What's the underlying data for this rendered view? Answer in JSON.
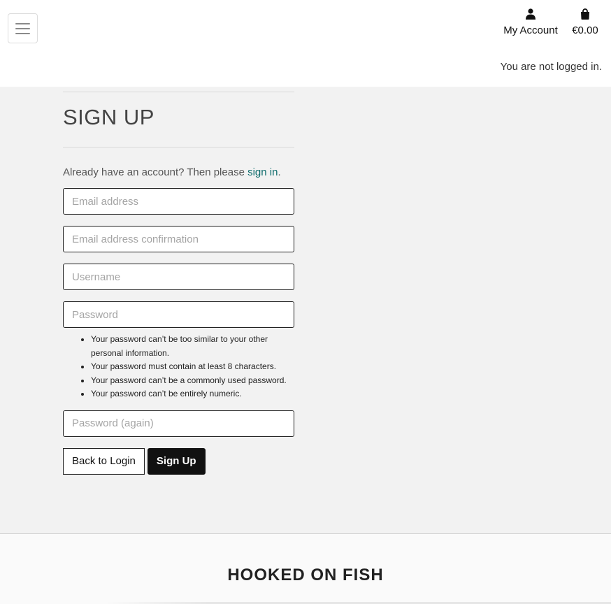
{
  "header": {
    "menu_icon": "hamburger-menu-icon",
    "account": {
      "icon": "user-icon",
      "label": "My Account"
    },
    "bag": {
      "icon": "shopping-bag-icon",
      "label": "€0.00"
    },
    "login_status": "You are not logged in."
  },
  "signup": {
    "title": "SIGN UP",
    "prompt_text": "Already have an account? Then please ",
    "signin_link": "sign in",
    "prompt_end": ".",
    "email_placeholder": "Email address",
    "email_confirm_placeholder": "Email address confirmation",
    "username_placeholder": "Username",
    "password_placeholder": "Password",
    "password_help": [
      "Your password can’t be too similar to your other personal information.",
      "Your password must contain at least 8 characters.",
      "Your password can’t be a commonly used password.",
      "Your password can’t be entirely numeric."
    ],
    "password_again_placeholder": "Password (again)",
    "back_button": "Back to Login",
    "submit_button": "Sign Up"
  },
  "footer": {
    "brand": "HOOKED ON FISH"
  },
  "colors": {
    "link": "#0d6b6b",
    "primary_button": "#111111",
    "page_background": "#f2f2f2"
  }
}
